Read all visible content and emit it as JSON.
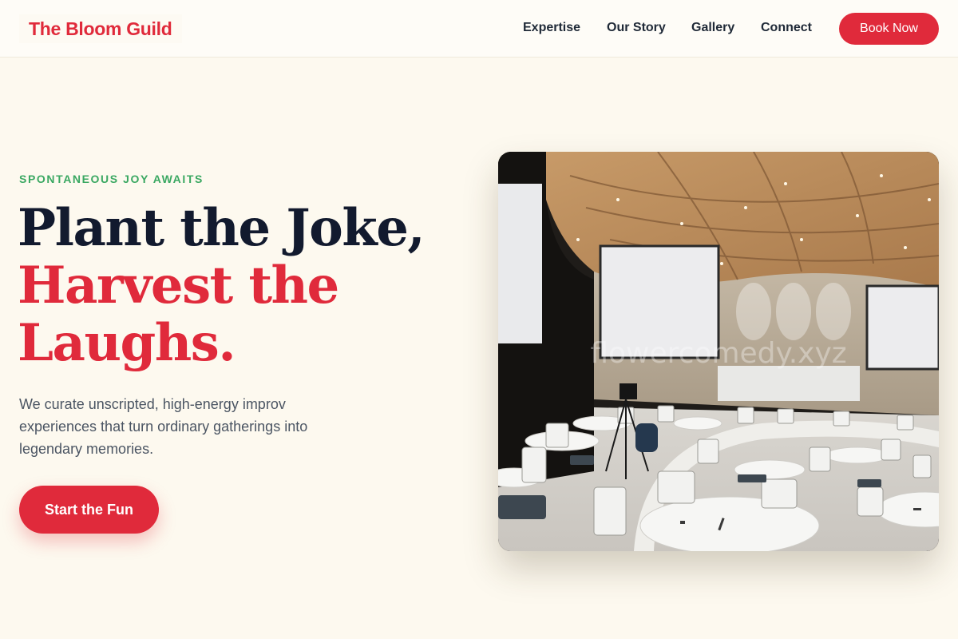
{
  "brand": {
    "name": "The Bloom Guild",
    "accent": "#e02a3b",
    "green": "#3aa862"
  },
  "nav": {
    "items": [
      {
        "label": "Expertise"
      },
      {
        "label": "Our Story"
      },
      {
        "label": "Gallery"
      },
      {
        "label": "Connect"
      }
    ],
    "cta_label": "Book Now"
  },
  "hero": {
    "eyebrow": "SPONTANEOUS JOY AWAITS",
    "headline_line1": "Plant the Joke,",
    "headline_line2": "Harvest the",
    "headline_line3": "Laughs.",
    "description": "We curate unscripted, high-energy improv experiences that turn ordinary gatherings into legendary memories.",
    "cta_label": "Start the Fun",
    "image_watermark": "flowercomedy.xyz"
  }
}
